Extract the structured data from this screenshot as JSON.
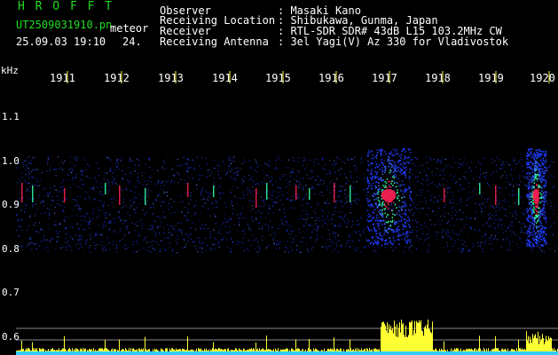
{
  "header": {
    "app_name": "H R O F F T",
    "filename": "UT2509031910.pn",
    "tag": "meteor",
    "datetime": "25.09.03 19:10",
    "count": "24.",
    "fields": [
      {
        "label": "Observer",
        "value": ": Masaki Kano"
      },
      {
        "label": "Receiving Location",
        "value": ": Shibukawa, Gunma, Japan"
      },
      {
        "label": "Receiver",
        "value": ": RTL-SDR SDR# 43dB L15 103.2MHz CW"
      },
      {
        "label": "Receiving Antenna",
        "value": ": 3el Yagi(V) Az 330 for Vladivostok"
      }
    ]
  },
  "axis": {
    "unit": "kHz",
    "y_ticks": [
      "1.1",
      "1.0",
      "0.9",
      "0.8",
      "0.7",
      "0.6"
    ],
    "time_ticks": [
      "1911",
      "1912",
      "1913",
      "1914",
      "1915",
      "1916",
      "1917",
      "1918",
      "1919",
      "1920"
    ]
  },
  "colors": {
    "background": "#000000",
    "header_green": "#22dd22",
    "tick_yellow": "#ffff44",
    "noise_blue": "#1f3cff",
    "echo_red": "#ff2255",
    "echo_green": "#33ffaa",
    "amplitude_yellow": "#ffff33",
    "baseline_cyan": "#33ccff"
  }
}
